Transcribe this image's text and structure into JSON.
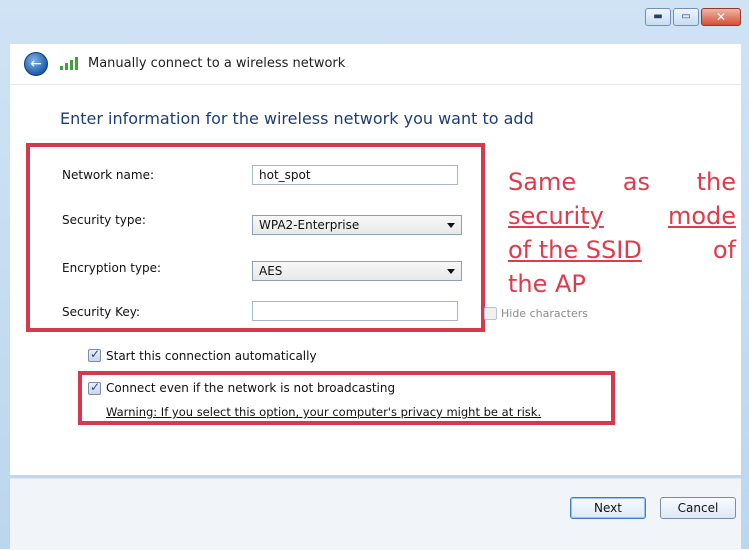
{
  "window": {
    "title": "Manually connect to a wireless network",
    "buttons": {
      "minimize": "minimize",
      "maximize": "maximize",
      "close": "close"
    }
  },
  "content": {
    "heading": "Enter information for the wireless network you want to add",
    "fields": {
      "network_name_label": "Network name:",
      "network_name_value": "hot_spot",
      "security_type_label": "Security type:",
      "security_type_value": "WPA2-Enterprise",
      "encryption_type_label": "Encryption type:",
      "encryption_type_value": "AES",
      "security_key_label": "Security Key:",
      "security_key_value": ""
    },
    "hide_characters_label": "Hide characters",
    "hide_characters_checked": false,
    "start_automatically_label": "Start this connection automatically",
    "start_automatically_checked": true,
    "connect_even_if_label": "Connect even if the network is not broadcasting",
    "connect_even_if_checked": true,
    "warning_text": "Warning: If you select this option, your computer's privacy might be at risk."
  },
  "annotation": {
    "line1_a": "Same",
    "line1_b": "as",
    "line1_c": "the",
    "line2_a": "security",
    "line2_b": "mode",
    "line3_a": "of the SSID",
    "line3_b": "of",
    "line4": "the AP",
    "color": "#e03a4c"
  },
  "footer": {
    "next_label": "Next",
    "cancel_label": "Cancel"
  },
  "colors": {
    "highlight_box": "#d6394e",
    "heading": "#1e3d78"
  }
}
